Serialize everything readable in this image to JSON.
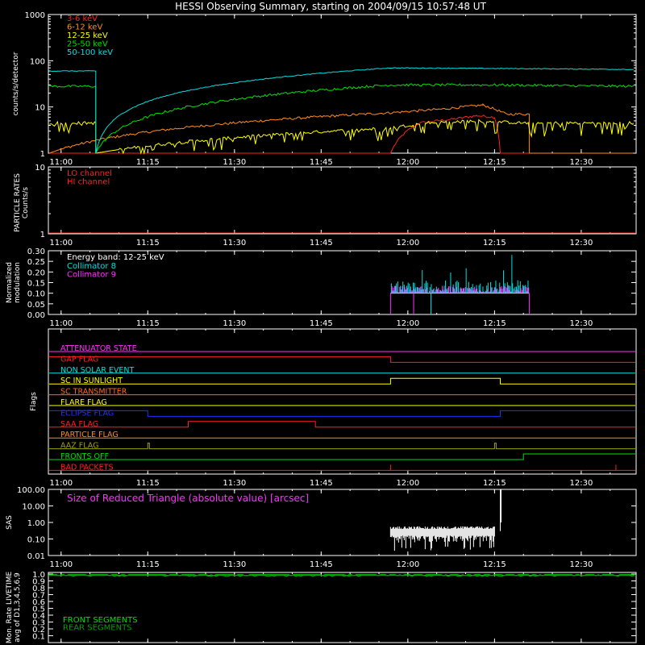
{
  "title": "HESSI Observing Summary, starting on 2004/09/15 10:57:48 UT",
  "colors": {
    "background": "#000000",
    "axes": "#ffffff",
    "red": "#ff2020",
    "orange": "#ff8c1a",
    "yellow": "#ffff00",
    "green": "#00e000",
    "cyan": "#00e0e0",
    "magenta": "#ff30ff",
    "blue": "#2030ff",
    "olive": "#a0a000",
    "dark_orange": "#ff6a1a",
    "dark_green": "#00a000"
  },
  "chart_data": [
    {
      "type": "line",
      "panel": "count-rates",
      "ylabel": "counts/s/detector",
      "yscale": "log",
      "ylim": [
        1,
        1000
      ],
      "yticks": [
        "1",
        "10",
        "100",
        "1000"
      ],
      "x_ticks": [
        "11:00",
        "11:15",
        "11:30",
        "11:45",
        "12:00",
        "12:15",
        "12:30"
      ],
      "legend_position": "top-left",
      "series": [
        {
          "name": "3-6 keV",
          "color": "#ff2020",
          "x": [
            "10:58",
            "11:57",
            "12:02",
            "12:08",
            "12:12",
            "12:15",
            "12:16",
            "12:21"
          ],
          "y": [
            1,
            1,
            4.5,
            5.5,
            6.5,
            6,
            1,
            1
          ]
        },
        {
          "name": "6-12 keV",
          "color": "#ff8c1a",
          "x": [
            "10:58",
            "11:57",
            "12:00",
            "12:06",
            "12:13",
            "12:17",
            "12:21",
            "12:21",
            "12:39"
          ],
          "y": [
            1,
            7.5,
            8,
            9,
            11,
            7,
            7,
            1,
            1
          ]
        },
        {
          "name": "12-25 keV",
          "color": "#ffff00",
          "x": [
            "10:58",
            "11:06",
            "11:06",
            "11:57",
            "12:03",
            "12:12",
            "12:20",
            "12:30",
            "12:39"
          ],
          "y": [
            4.5,
            4.5,
            1,
            3.5,
            4.5,
            5,
            4.5,
            4.5,
            4.5
          ]
        },
        {
          "name": "25-50 keV",
          "color": "#00e000",
          "x": [
            "10:58",
            "11:06",
            "11:06",
            "11:57",
            "12:15",
            "12:39"
          ],
          "y": [
            28,
            28,
            1,
            30,
            30,
            28
          ]
        },
        {
          "name": "50-100 keV",
          "color": "#00e0e0",
          "x": [
            "10:58",
            "11:06",
            "11:06",
            "11:57",
            "12:15",
            "12:39"
          ],
          "y": [
            60,
            60,
            1,
            70,
            68,
            65
          ]
        }
      ]
    },
    {
      "type": "line",
      "panel": "particle-rates",
      "ylabel": "PARTICLE RATES\nCounts/s",
      "yticks": [
        "1",
        "10"
      ],
      "x_ticks": [
        "11:00",
        "11:15",
        "11:30",
        "11:45",
        "12:00",
        "12:15",
        "12:30"
      ],
      "series": [
        {
          "name": "LO channel",
          "color": "#ff2020"
        },
        {
          "name": "HI channel",
          "color": "#ff2020"
        }
      ]
    },
    {
      "type": "line",
      "panel": "modulation",
      "ylabel": "Normalized\nmodulation",
      "ylim": [
        0,
        0.3
      ],
      "yticks": [
        "0.00",
        "0.05",
        "0.10",
        "0.15",
        "0.20",
        "0.25",
        "0.30"
      ],
      "x_ticks": [
        "11:00",
        "11:15",
        "11:30",
        "11:45",
        "12:00",
        "12:15",
        "12:30"
      ],
      "annotation": "Energy band: 12-25 keV",
      "series": [
        {
          "name": "Collimator 8",
          "color": "#00e0e0",
          "x": [
            "11:57",
            "12:21"
          ],
          "y": [
            0.1,
            0.1
          ]
        },
        {
          "name": "Collimator 9",
          "color": "#ff30ff",
          "x": [
            "11:57",
            "12:21"
          ],
          "y": [
            0.11,
            0.11
          ]
        }
      ]
    },
    {
      "type": "line",
      "panel": "flags",
      "ylabel": "Flags",
      "x_ticks": [
        "11:00",
        "11:15",
        "11:30",
        "11:45",
        "12:00",
        "12:15",
        "12:30"
      ],
      "series": [
        {
          "name": "ATTENUATOR STATE",
          "color": "#ff30ff"
        },
        {
          "name": "GAP FLAG",
          "color": "#ff2020"
        },
        {
          "name": "NON SOLAR EVENT",
          "color": "#00e0e0"
        },
        {
          "name": "SC IN SUNLIGHT",
          "color": "#ffff00"
        },
        {
          "name": "SC TRANSMITTER",
          "color": "#ff6a1a"
        },
        {
          "name": "FLARE FLAG",
          "color": "#ffff00"
        },
        {
          "name": "ECLIPSE FLAG",
          "color": "#2030ff"
        },
        {
          "name": "SAA FLAG",
          "color": "#ff2020"
        },
        {
          "name": "PARTICLE FLAG",
          "color": "#ff8c1a"
        },
        {
          "name": "AAZ FLAG",
          "color": "#a0a000"
        },
        {
          "name": "FRONTS OFF",
          "color": "#00e000"
        },
        {
          "name": "BAD PACKETS",
          "color": "#ff2020"
        }
      ]
    },
    {
      "type": "line",
      "panel": "sas",
      "ylabel": "SAS",
      "yscale": "log",
      "ylim": [
        0.01,
        100
      ],
      "yticks": [
        "0.01",
        "0.10",
        "1.00",
        "10.00",
        "100.00"
      ],
      "x_ticks": [
        "11:00",
        "11:15",
        "11:30",
        "11:45",
        "12:00",
        "12:15",
        "12:30"
      ],
      "annotation": "Size of Reduced Triangle (absolute value) [arcsec]",
      "series": [
        {
          "name": "Size of Reduced Triangle (absolute value) [arcsec]",
          "color": "#ffffff",
          "x": [
            "11:57",
            "12:15",
            "12:16",
            "12:16"
          ],
          "y": [
            0.3,
            0.3,
            100,
            0.3
          ]
        }
      ]
    },
    {
      "type": "line",
      "panel": "livetime",
      "ylabel": "Mon. Rate LIVETIME\navg of D1,3,4,5,6,9",
      "yticks": [
        "0.1",
        "0.2",
        "0.3",
        "0.4",
        "0.5",
        "0.6",
        "0.7",
        "0.8",
        "0.9",
        "1.0"
      ],
      "ylim": [
        0,
        1.0
      ],
      "series": [
        {
          "name": "FRONT SEGMENTS",
          "color": "#00e000",
          "x": [
            "10:58",
            "12:39"
          ],
          "y": [
            0.99,
            0.99
          ]
        },
        {
          "name": "REAR SEGMENTS",
          "color": "#00a000",
          "x": [
            "10:58",
            "12:39"
          ],
          "y": [
            0.98,
            0.98
          ]
        }
      ]
    }
  ]
}
